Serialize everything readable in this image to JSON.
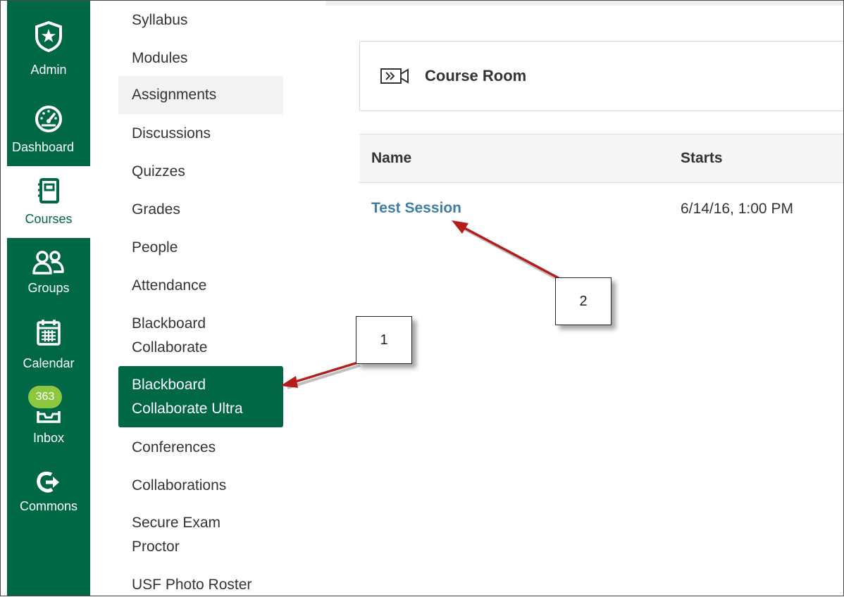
{
  "global_nav": {
    "items": [
      {
        "label": "Admin",
        "icon": "shield-star-icon"
      },
      {
        "label": "Dashboard",
        "icon": "speedometer-icon"
      },
      {
        "label": "Courses",
        "icon": "notebook-icon"
      },
      {
        "label": "Groups",
        "icon": "users-icon"
      },
      {
        "label": "Calendar",
        "icon": "calendar-icon"
      },
      {
        "label": "Inbox",
        "icon": "inbox-tray-icon",
        "badge": "363"
      },
      {
        "label": "Commons",
        "icon": "share-arrow-icon"
      }
    ],
    "active": "Courses"
  },
  "course_nav": {
    "items": [
      {
        "label": "Syllabus"
      },
      {
        "label": "Modules"
      },
      {
        "label": "Assignments"
      },
      {
        "label": "Discussions"
      },
      {
        "label": "Quizzes"
      },
      {
        "label": "Grades"
      },
      {
        "label": "People"
      },
      {
        "label": "Attendance"
      },
      {
        "label_line1": "Blackboard",
        "label_line2": "Collaborate"
      },
      {
        "label_line1": "Blackboard",
        "label_line2": "Collaborate Ultra"
      },
      {
        "label": "Conferences"
      },
      {
        "label": "Collaborations"
      },
      {
        "label_line1": "Secure Exam",
        "label_line2": "Proctor"
      },
      {
        "label": "USF Photo Roster"
      }
    ],
    "active": "Blackboard Collaborate Ultra",
    "hovered": "Assignments"
  },
  "course_room": {
    "title": "Course Room",
    "icon": "video-camera-icon"
  },
  "sessions_table": {
    "columns": [
      "Name",
      "Starts"
    ],
    "rows": [
      {
        "name": "Test Session",
        "starts": "6/14/16, 1:00 PM"
      }
    ]
  },
  "callouts": {
    "one": "1",
    "two": "2"
  },
  "colors": {
    "brand_green": "#006747",
    "badge_green": "#8dc63f",
    "link_blue": "#3d7ea6",
    "arrow_red": "#b51d1d"
  }
}
